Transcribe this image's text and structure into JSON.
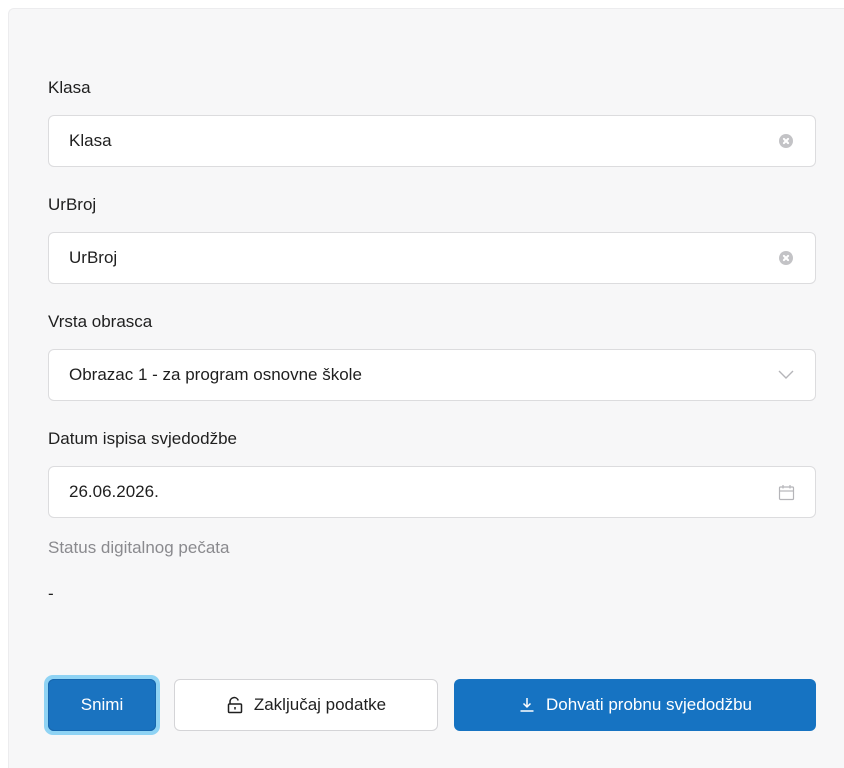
{
  "form": {
    "klasa": {
      "label": "Klasa",
      "value": "Klasa"
    },
    "urbroj": {
      "label": "UrBroj",
      "value": "UrBroj"
    },
    "vrsta": {
      "label": "Vrsta obrasca",
      "value": "Obrazac 1 - za program osnovne škole"
    },
    "datum": {
      "label": "Datum ispisa svjedodžbe",
      "value": "26.06.2026."
    },
    "status": {
      "label": "Status digitalnog pečata",
      "value": "-"
    }
  },
  "actions": {
    "save_label": "Snimi",
    "lock_label": "Zaključaj podatke",
    "fetch_label": "Dohvati probnu svjedodžbu"
  },
  "icons": {
    "clear": "clear-circle-icon",
    "dropdown": "chevron-down-icon",
    "calendar": "calendar-icon",
    "lock": "unlock-icon",
    "download": "download-icon"
  },
  "colors": {
    "primary": "#1673c2",
    "focus_ring": "#8fd3f4",
    "muted_text": "#8a8a8e"
  }
}
